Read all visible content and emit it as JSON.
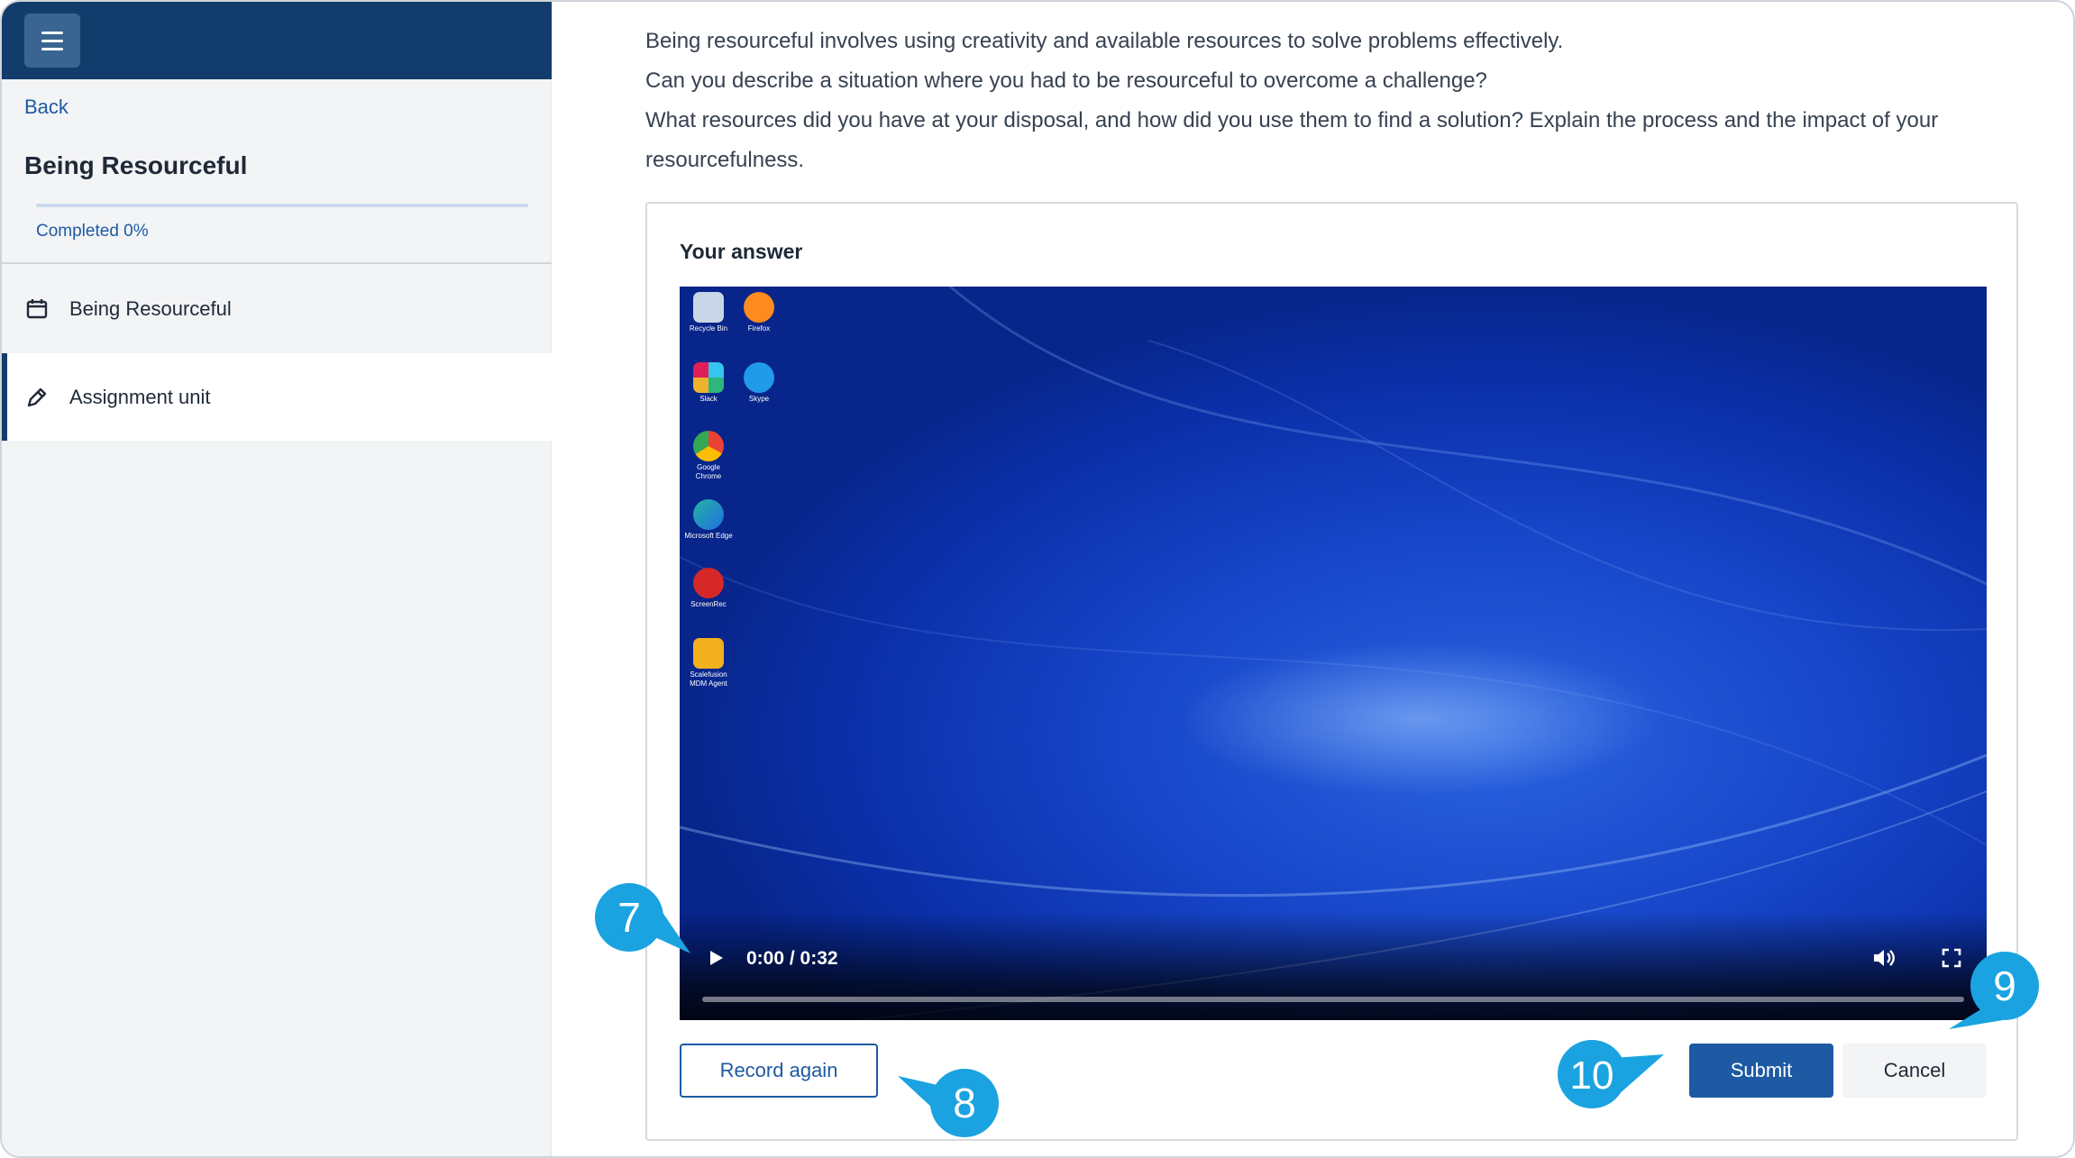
{
  "sidebar": {
    "menu_icon": "hamburger-menu-icon",
    "back_label": "Back",
    "course_title": "Being Resourceful",
    "progress": {
      "percent": 0,
      "label": "Completed 0%"
    },
    "items": [
      {
        "label": "Being Resourceful",
        "icon": "calendar-icon"
      },
      {
        "label": "Assignment unit",
        "icon": "pencil-icon",
        "active": true
      }
    ]
  },
  "question": {
    "lines": [
      "Being resourceful involves using creativity and available resources to solve problems effectively.",
      "Can you describe a situation where you had to be resourceful to overcome a challenge?",
      "What resources did you have at your disposal, and how did you use them to find a solution? Explain the process and the impact of your resourcefulness."
    ]
  },
  "answer": {
    "label": "Your answer",
    "video": {
      "time": "0:00 / 0:32",
      "progress": 0,
      "desktop_icons": [
        {
          "name": "Recycle Bin",
          "color": "#c9d6e8"
        },
        {
          "name": "Firefox",
          "color": "#ff8a1f"
        },
        {
          "name": "Slack",
          "color": "#ffffff"
        },
        {
          "name": "Skype",
          "color": "#1f9be8"
        },
        {
          "name": "Google Chrome",
          "color": "#ea4335"
        },
        {
          "name": "Microsoft Edge",
          "color": "#25b3a4"
        },
        {
          "name": "ScreenRec",
          "color": "#d62828"
        },
        {
          "name": "Scalefusion MDM Agent",
          "color": "#f2b01e"
        }
      ]
    },
    "record_again_label": "Record again",
    "submit_label": "Submit",
    "cancel_label": "Cancel"
  },
  "callouts": [
    "7",
    "8",
    "9",
    "10"
  ],
  "colors": {
    "brand_dark": "#123c6b",
    "accent": "#1d5aa3",
    "callout": "#1aa3e0"
  }
}
